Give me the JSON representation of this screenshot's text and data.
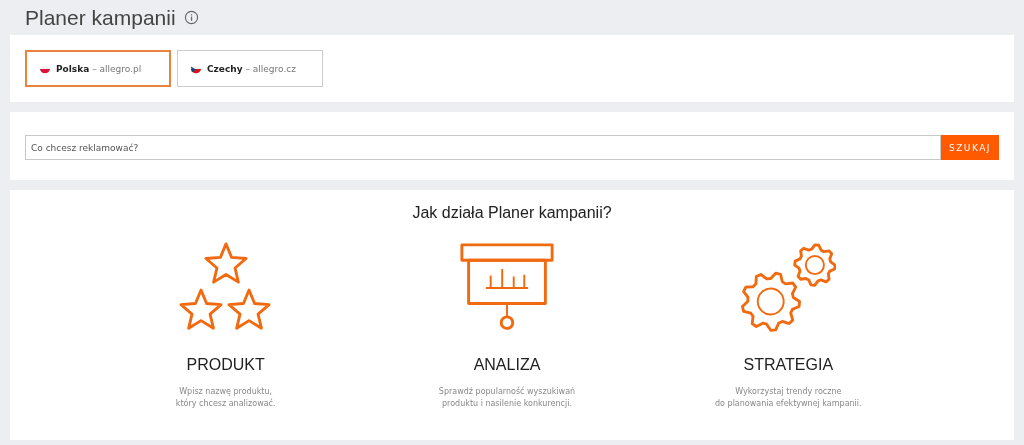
{
  "page": {
    "title": "Planer kampanii"
  },
  "markets": [
    {
      "country": "Polska",
      "domain": "– allegro.pl",
      "kind": "pl",
      "selected": true
    },
    {
      "country": "Czechy",
      "domain": "– allegro.cz",
      "kind": "cz",
      "selected": false
    }
  ],
  "search": {
    "placeholder": "Co chcesz reklamować?",
    "button": "SZUKAJ"
  },
  "how_it_works": {
    "heading": "Jak działa Planer kampanii?",
    "steps": [
      {
        "kind": "stars",
        "title": "PRODUKT",
        "text": "Wpisz nazwę produktu,\nktóry chcesz analizować."
      },
      {
        "kind": "presentation",
        "title": "ANALIZA",
        "text": "Sprawdź popularność wyszukiwań\nproduktu i nasilenie konkurencji."
      },
      {
        "kind": "gears",
        "title": "STRATEGIA",
        "text": "Wykorzystaj trendy roczne\ndo planowania efektywnej kampanii."
      }
    ]
  }
}
